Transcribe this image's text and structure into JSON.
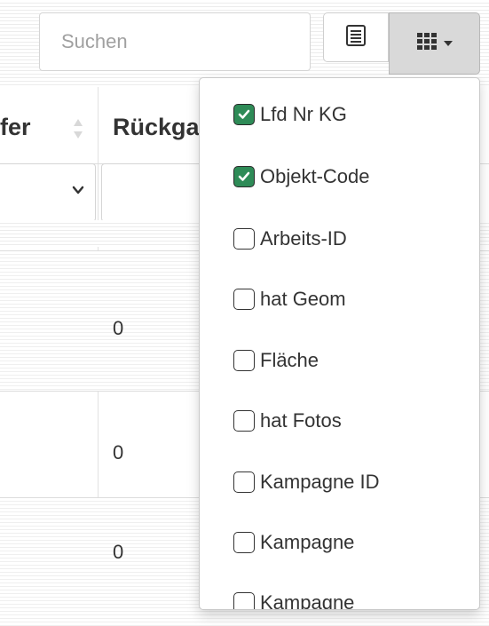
{
  "toolbar": {
    "search_placeholder": "Suchen"
  },
  "table": {
    "columns": [
      {
        "label": "fer"
      },
      {
        "label": "Rückga"
      }
    ],
    "rows": [
      {
        "value": "0"
      },
      {
        "value": "0"
      },
      {
        "value": "0"
      }
    ]
  },
  "column_menu": {
    "check_color": "#2e8b57",
    "items": [
      {
        "label": "Lfd Nr KG",
        "checked": true
      },
      {
        "label": "Objekt-Code",
        "checked": true
      },
      {
        "label": "Arbeits-ID",
        "checked": false
      },
      {
        "label": "hat Geom",
        "checked": false
      },
      {
        "label": "Fläche",
        "checked": false
      },
      {
        "label": "hat Fotos",
        "checked": false
      },
      {
        "label": "Kampagne ID",
        "checked": false
      },
      {
        "label": "Kampagne",
        "checked": false
      },
      {
        "label": "Kampagne",
        "checked": false
      }
    ]
  }
}
